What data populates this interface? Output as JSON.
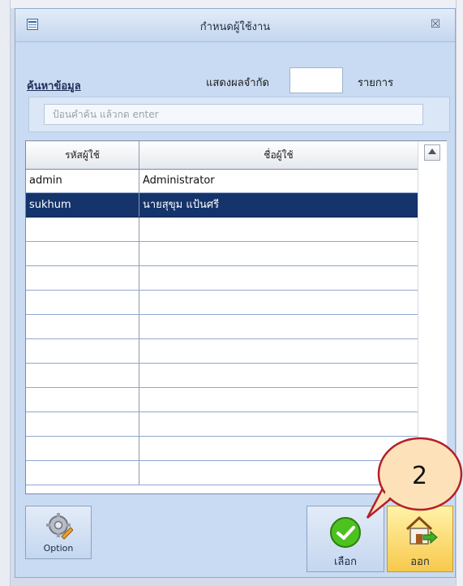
{
  "window": {
    "title": "กำหนดผู้ใช้งาน",
    "close_glyph": "☒"
  },
  "limit": {
    "label": "แสดงผลจำกัด",
    "value": "",
    "unit": "รายการ"
  },
  "search": {
    "title": "ค้นหาข้อมูล",
    "placeholder": "ป้อนคำค้น แล้วกด enter",
    "value": ""
  },
  "table": {
    "columns": [
      "รหัสผู้ใช้",
      "ชื่อผู้ใช้"
    ],
    "rows": [
      {
        "id": "admin",
        "name": "Administrator",
        "selected": false
      },
      {
        "id": "sukhum",
        "name": "นายสุขุม  แป้นศรี",
        "selected": true
      }
    ],
    "empty_rows": 11
  },
  "buttons": {
    "option": "Option",
    "select": "เลือก",
    "exit": "ออก"
  },
  "callout": {
    "number": "2"
  },
  "colors": {
    "selected_row": "#14346b",
    "dialog_bg": "#c9dbf2",
    "exit_button": "#f7c94c",
    "check_green": "#4cc21f"
  },
  "icons": [
    "form-icon",
    "close-icon",
    "gear-pencil-icon",
    "check-circle-icon",
    "home-exit-icon"
  ]
}
